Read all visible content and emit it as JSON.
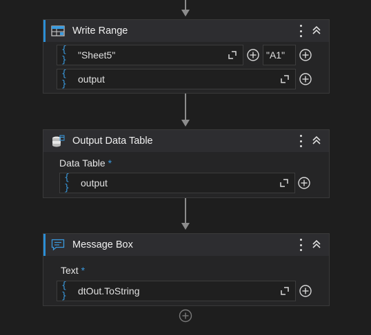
{
  "activities": {
    "write_range": {
      "title": "Write Range",
      "sheet_value": "\"Sheet5\"",
      "cell_value": "\"A1\"",
      "data_value": "output"
    },
    "output_data_table": {
      "title": "Output Data Table",
      "data_table_label": "Data Table",
      "required_mark": "*",
      "data_table_value": "output"
    },
    "message_box": {
      "title": "Message Box",
      "text_label": "Text",
      "required_mark": "*",
      "text_value": "dtOut.ToString"
    }
  },
  "field_prefix": "{ }",
  "colors": {
    "accent": "#2b8fd6",
    "background": "#1e1e1e",
    "connector": "#8c8c8c"
  },
  "icons": [
    "excel-range-icon",
    "data-table-icon",
    "message-box-icon",
    "more-options-icon",
    "collapse-icon",
    "expand-icon",
    "add-circle-icon"
  ]
}
